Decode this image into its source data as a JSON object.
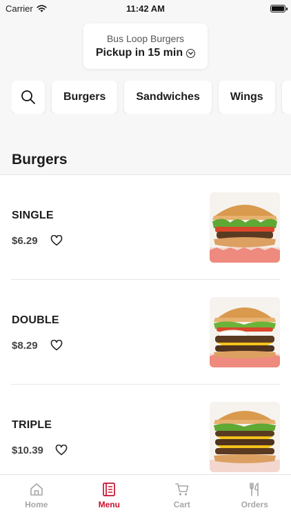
{
  "status_bar": {
    "carrier": "Carrier",
    "time": "11:42 AM"
  },
  "location": {
    "name": "Bus Loop Burgers",
    "pickup": "Pickup in 15 min"
  },
  "categories": [
    "Burgers",
    "Sandwiches",
    "Wings"
  ],
  "section": {
    "title": "Burgers"
  },
  "menu_items": [
    {
      "name": "SINGLE",
      "price": "$6.29"
    },
    {
      "name": "DOUBLE",
      "price": "$8.29"
    },
    {
      "name": "TRIPLE",
      "price": "$10.39"
    }
  ],
  "tabs": [
    {
      "label": "Home",
      "icon": "home-icon"
    },
    {
      "label": "Menu",
      "icon": "menu-book-icon"
    },
    {
      "label": "Cart",
      "icon": "cart-icon"
    },
    {
      "label": "Orders",
      "icon": "utensils-icon"
    }
  ],
  "colors": {
    "accent": "#c8102e",
    "inactive": "#a6a6a6"
  }
}
